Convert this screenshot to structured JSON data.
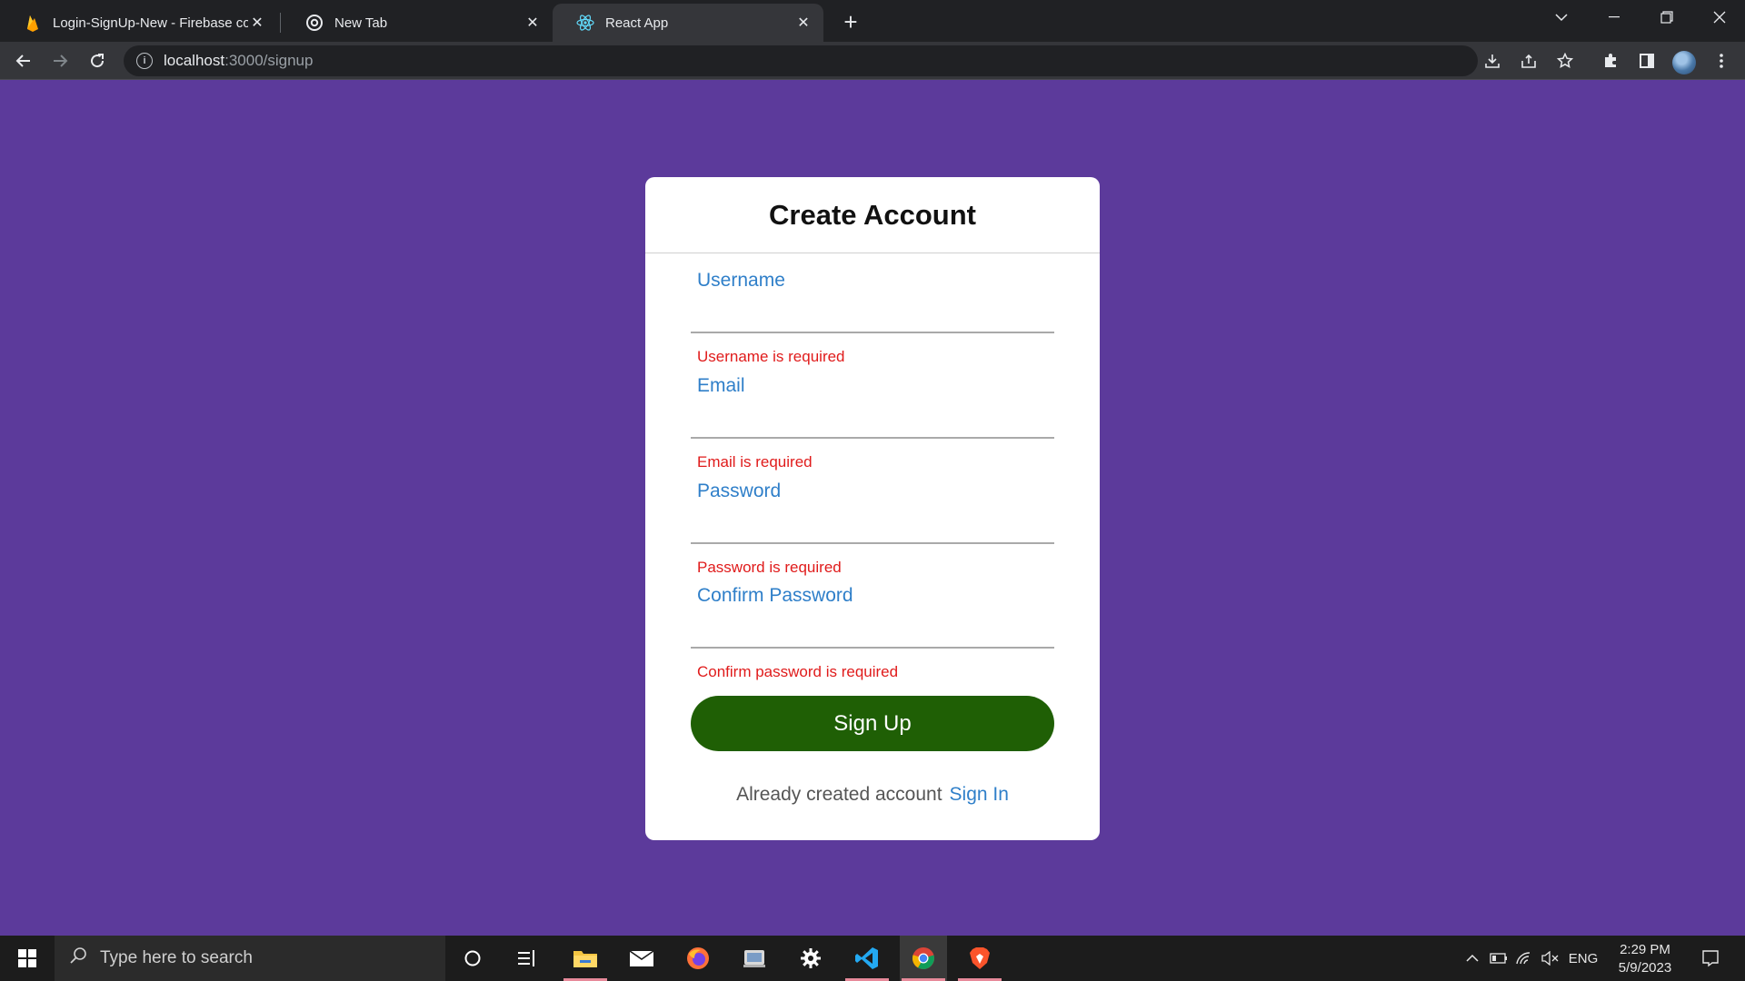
{
  "browser": {
    "tabs": [
      {
        "title": "Login-SignUp-New - Firebase co",
        "icon": "firebase-icon"
      },
      {
        "title": "New Tab",
        "icon": "chrome-icon"
      },
      {
        "title": "React App",
        "icon": "react-icon"
      }
    ],
    "url_host": "localhost",
    "url_path": ":3000/signup"
  },
  "form": {
    "title": "Create Account",
    "fields": [
      {
        "label": "Username",
        "value": "",
        "error": "Username is required"
      },
      {
        "label": "Email",
        "value": "",
        "error": "Email is required"
      },
      {
        "label": "Password",
        "value": "",
        "error": "Password is required"
      },
      {
        "label": "Confirm Password",
        "value": "",
        "error": "Confirm password is required"
      }
    ],
    "submit_label": "Sign Up",
    "footer_text": "Already created account",
    "footer_link": "Sign In"
  },
  "taskbar": {
    "search_placeholder": "Type here to search",
    "language": "ENG",
    "time": "2:29 PM",
    "date": "5/9/2023"
  },
  "colors": {
    "page_background": "#5c3a9b",
    "button": "#1f5f05",
    "label": "#2f7fc9",
    "error": "#e01b1b"
  }
}
